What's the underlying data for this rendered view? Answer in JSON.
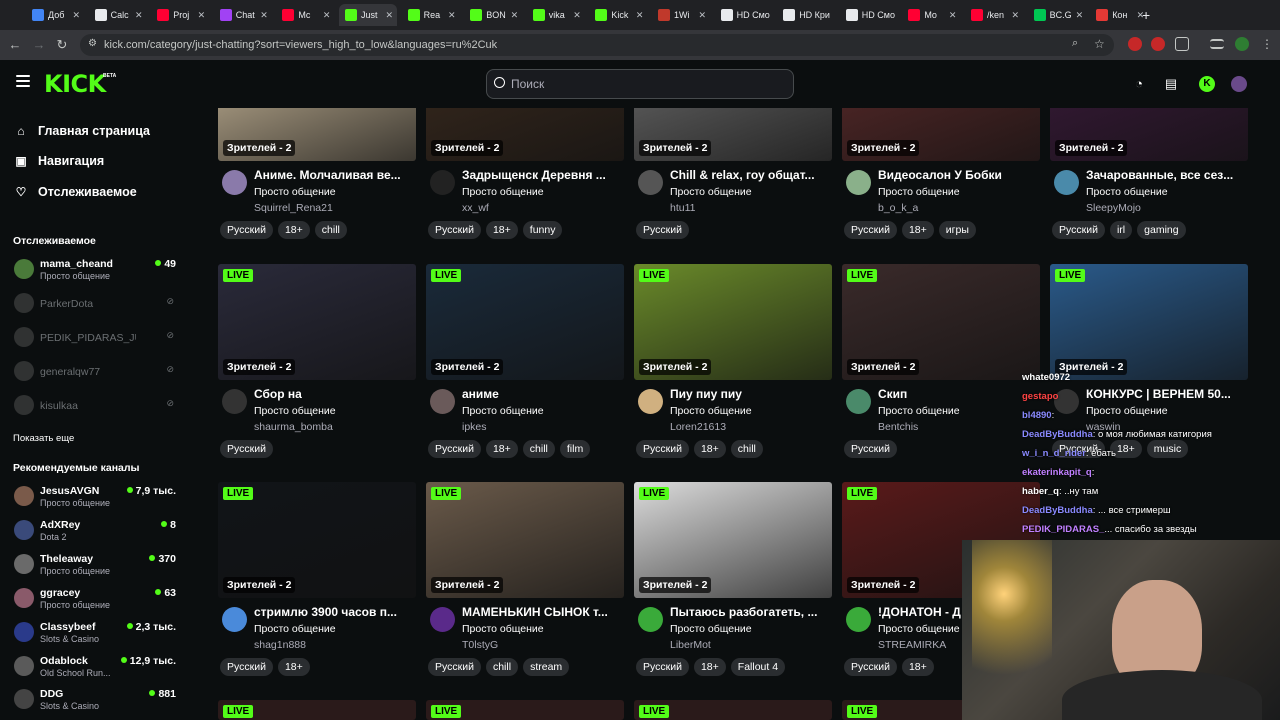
{
  "browser": {
    "tabs": [
      {
        "label": "Доб",
        "color": "#4285f4"
      },
      {
        "label": "Calc",
        "color": "#e8eaed"
      },
      {
        "label": "Proj",
        "color": "#ff0033"
      },
      {
        "label": "Chat",
        "color": "#a142f4"
      },
      {
        "label": "Mc",
        "color": "#ff0033"
      },
      {
        "label": "Just",
        "color": "#53fc18"
      },
      {
        "label": "Rea",
        "color": "#53fc18"
      },
      {
        "label": "BON",
        "color": "#53fc18"
      },
      {
        "label": "vika",
        "color": "#53fc18"
      },
      {
        "label": "Kick",
        "color": "#53fc18"
      },
      {
        "label": "1Wi",
        "color": "#c0392b"
      },
      {
        "label": "HD Смо",
        "color": "#e8eaed"
      },
      {
        "label": "HD Кри",
        "color": "#e8eaed"
      },
      {
        "label": "HD Смо",
        "color": "#e8eaed"
      },
      {
        "label": "Mo",
        "color": "#ff0033"
      },
      {
        "label": "/ken",
        "color": "#ff0033"
      },
      {
        "label": "BC.G",
        "color": "#00c853"
      },
      {
        "label": "Кон",
        "color": "#e53935"
      }
    ],
    "url": "kick.com/category/just-chatting?sort=viewers_high_to_low&languages=ru%2Cuk"
  },
  "header": {
    "logo": "KICK",
    "logo_beta": "BETA",
    "search_placeholder": "Поиск"
  },
  "sidebar": {
    "nav": [
      {
        "icon": "home-icon",
        "glyph": "⌂",
        "label": "Главная страница"
      },
      {
        "icon": "compass-icon",
        "glyph": "▣",
        "label": "Навигация"
      },
      {
        "icon": "heart-icon",
        "glyph": "♡",
        "label": "Отслеживаемое"
      }
    ],
    "following_title": "Отслеживаемое",
    "following": [
      {
        "name": "mama_cheand",
        "category": "Просто общение",
        "viewers": "49",
        "live": true,
        "color": "#4a7a3a"
      },
      {
        "name": "ParkerDota",
        "category": "",
        "viewers": "",
        "live": false,
        "color": "#555"
      },
      {
        "name": "PEDIK_PIDARAS_JUG...",
        "category": "",
        "viewers": "",
        "live": false,
        "color": "#555"
      },
      {
        "name": "generalqw77",
        "category": "",
        "viewers": "",
        "live": false,
        "color": "#555"
      },
      {
        "name": "kisulkaa",
        "category": "",
        "viewers": "",
        "live": false,
        "color": "#555"
      }
    ],
    "show_more": "Показать еще",
    "recommended_title": "Рекомендуемые каналы",
    "recommended": [
      {
        "name": "JesusAVGN",
        "category": "Просто общение",
        "viewers": "7,9 тыс.",
        "color": "#7a5a4a"
      },
      {
        "name": "AdXRey",
        "category": "Dota 2",
        "viewers": "8",
        "color": "#3a4a7a"
      },
      {
        "name": "Theleaway",
        "category": "Просто общение",
        "viewers": "370",
        "color": "#6a6a6a"
      },
      {
        "name": "ggracey",
        "category": "Просто общение",
        "viewers": "63",
        "color": "#8a5a6a"
      },
      {
        "name": "Classybeef",
        "category": "Slots & Casino",
        "viewers": "2,3 тыс.",
        "color": "#2a3a8a"
      },
      {
        "name": "Odablock",
        "category": "Old School Run...",
        "viewers": "12,9 тыс.",
        "color": "#5a5a5a"
      },
      {
        "name": "DDG",
        "category": "Slots & Casino",
        "viewers": "881",
        "color": "#444"
      }
    ]
  },
  "streams": [
    {
      "title": "Аниме. Молчаливая ве...",
      "category": "Просто общение",
      "user": "Squirrel_Rena21",
      "viewers": "Зрителей - 2",
      "tags": [
        "Русский",
        "18+",
        "chill"
      ],
      "thumb": "#c9b89a",
      "avatar": "#8a7aaa"
    },
    {
      "title": "Задрыщенск Деревня ...",
      "category": "Просто общение",
      "user": "xx_wf",
      "viewers": "Зрителей - 2",
      "tags": [
        "Русский",
        "18+",
        "funny"
      ],
      "thumb": "#3a2a1e",
      "avatar": "#222"
    },
    {
      "title": "Chill & relax, гоу общат...",
      "category": "Просто общение",
      "user": "htu11",
      "viewers": "Зрителей - 2",
      "tags": [
        "Русский"
      ],
      "thumb": "#6a6a6a",
      "avatar": "#555"
    },
    {
      "title": "Видеосалон У Бобки",
      "category": "Просто общение",
      "user": "b_o_k_a",
      "viewers": "Зрителей - 2",
      "tags": [
        "Русский",
        "18+",
        "игры"
      ],
      "thumb": "#5a2a2a",
      "avatar": "#8ab08a"
    },
    {
      "title": "Зачарованные, все сез...",
      "category": "Просто общение",
      "user": "SleepyMojo",
      "viewers": "Зрителей - 2",
      "tags": [
        "Русский",
        "irl",
        "gaming"
      ],
      "thumb": "#3a1a3a",
      "avatar": "#4a8aaa"
    },
    {
      "title": "Сбор на",
      "category": "Просто общение",
      "user": "shaurma_bomba",
      "viewers": "Зрителей - 2",
      "tags": [
        "Русский"
      ],
      "thumb": "#2a2a3a",
      "avatar": "#333",
      "live": "LIVE"
    },
    {
      "title": "аниме",
      "category": "Просто общение",
      "user": "ipkes",
      "viewers": "Зрителей - 2",
      "tags": [
        "Русский",
        "18+",
        "chill",
        "film"
      ],
      "thumb": "#1a2a3a",
      "avatar": "#6a5a5a",
      "live": "LIVE"
    },
    {
      "title": "Пиу пиу пиу",
      "category": "Просто общение",
      "user": "Loren21613",
      "viewers": "Зрителей - 2",
      "tags": [
        "Русский",
        "18+",
        "chill"
      ],
      "thumb": "#6a8a2a",
      "avatar": "#d0b080",
      "live": "LIVE"
    },
    {
      "title": "Скип",
      "category": "Просто общение",
      "user": "Bentchis",
      "viewers": "Зрителей - 2",
      "tags": [
        "Русский"
      ],
      "thumb": "#3a2a2a",
      "avatar": "#4a8a6a",
      "live": "LIVE"
    },
    {
      "title": "КОНКУРС | ВЕРНЕМ 50...",
      "category": "Просто общение",
      "user": "waswin",
      "viewers": "Зрителей - 2",
      "tags": [
        "Русский",
        "18+",
        "music"
      ],
      "thumb": "#2a5a8a",
      "avatar": "#333",
      "live": "LIVE"
    },
    {
      "title": "стримлю 3900 часов п...",
      "category": "Просто общение",
      "user": "shag1n888",
      "viewers": "Зрителей - 2",
      "tags": [
        "Русский",
        "18+"
      ],
      "thumb": "#111418",
      "avatar": "#4a8ada",
      "live": "LIVE"
    },
    {
      "title": "МАМЕНЬКИН СЫНОК т...",
      "category": "Просто общение",
      "user": "T0lstyG",
      "viewers": "Зрителей - 2",
      "tags": [
        "Русский",
        "chill",
        "stream"
      ],
      "thumb": "#6a5a4a",
      "avatar": "#5a2a8a",
      "live": "LIVE"
    },
    {
      "title": "Пытаюсь разбогатеть, ...",
      "category": "Просто общение",
      "user": "LiberMot",
      "viewers": "Зрителей - 2",
      "tags": [
        "Русский",
        "18+",
        "Fallout 4"
      ],
      "thumb": "#dcdcdc",
      "avatar": "#3aaa3a",
      "live": "LIVE"
    },
    {
      "title": "!ДОНАТОН - Д",
      "category": "Просто общение",
      "user": "STREAMIRKA",
      "viewers": "Зрителей - 2",
      "tags": [
        "Русский",
        "18+"
      ],
      "thumb": "#5a1a1a",
      "avatar": "#3aaa3a",
      "live": "LIVE"
    }
  ],
  "bottom_live": [
    "LIVE",
    "LIVE",
    "LIVE",
    "LIVE"
  ],
  "chat": [
    {
      "user": "whate0972",
      "text": "",
      "color": "#ffffff"
    },
    {
      "user": "gestapo",
      "text": "",
      "color": "#ff4444"
    },
    {
      "user": "bl4890",
      "text": ":",
      "color": "#8a8aff"
    },
    {
      "user": "DeadByBuddha",
      "text": ": о моя любимая катигория",
      "color": "#8a8aff"
    },
    {
      "user": "w_i_n_d_rider",
      "text": ": ебать",
      "color": "#8a8aff"
    },
    {
      "user": "ekaterinkapit_q",
      "text": ":",
      "color": "#c080ff"
    },
    {
      "user": "haber_q",
      "text": ": ..ну там",
      "color": "#ffffff"
    },
    {
      "user": "DeadByBuddha",
      "text": ": ... все стримерш",
      "color": "#8a8aff"
    },
    {
      "user": "PEDIK_PIDARAS_",
      "text": "... спасибо за звезды",
      "color": "#c080ff"
    }
  ]
}
